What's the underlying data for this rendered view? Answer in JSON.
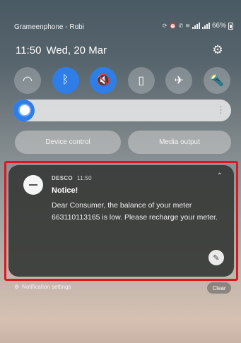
{
  "status_bar": {
    "carrier": "Grameenphone - Robi",
    "battery": "66%",
    "icons": [
      "sync-icon",
      "alarm-icon",
      "wifi-calling-icon",
      "volte-icon",
      "signal-sim1-icon",
      "signal-sim2-icon",
      "battery-icon"
    ]
  },
  "header": {
    "time": "11:50",
    "date": "Wed, 20 Mar"
  },
  "quick_settings": {
    "tiles": [
      {
        "icon": "wifi-icon",
        "glyph": "◠",
        "on": false
      },
      {
        "icon": "bluetooth-icon",
        "glyph": "ᛒ",
        "on": true
      },
      {
        "icon": "sound-off-icon",
        "glyph": "🔇",
        "on": true
      },
      {
        "icon": "phone-portrait-icon",
        "glyph": "▯",
        "on": false
      },
      {
        "icon": "airplane-icon",
        "glyph": "✈",
        "on": false
      },
      {
        "icon": "flashlight-icon",
        "glyph": "🔦",
        "on": false
      }
    ],
    "brightness_level": 0.1
  },
  "buttons": {
    "device_control": "Device control",
    "media_output": "Media output"
  },
  "notification": {
    "app_name": "DESCO",
    "time": "11:50",
    "title": "Notice!",
    "body": "Dear Consumer, the balance of your meter 663110113165 is low. Please recharge your meter."
  },
  "footer": {
    "settings": "Notification settings",
    "clear": "Clear"
  },
  "colors": {
    "accent": "#2f7de7",
    "highlight_border": "#e0161e"
  }
}
